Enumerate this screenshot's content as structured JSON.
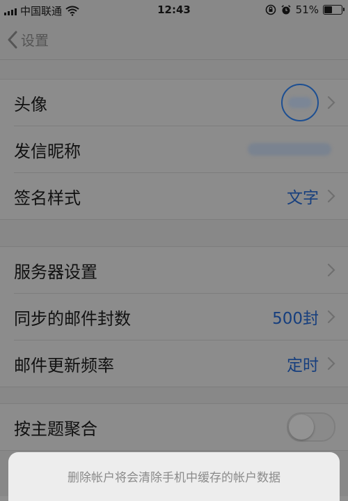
{
  "status_bar": {
    "carrier": "中国联通",
    "time": "12:43",
    "battery_text": "51%",
    "battery_level": 0.51
  },
  "nav": {
    "back_label": "设置"
  },
  "groups": [
    {
      "rows": [
        {
          "label": "头像",
          "value": ""
        },
        {
          "label": "发信昵称",
          "value": ""
        },
        {
          "label": "签名样式",
          "value": "文字"
        }
      ]
    },
    {
      "rows": [
        {
          "label": "服务器设置",
          "value": ""
        },
        {
          "label": "同步的邮件封数",
          "value": "500封"
        },
        {
          "label": "邮件更新频率",
          "value": "定时"
        }
      ]
    },
    {
      "rows": [
        {
          "label": "按主题聚合",
          "toggle_on": false
        }
      ]
    }
  ],
  "sheet": {
    "message": "删除帐户将会清除手机中缓存的帐户数据"
  },
  "colors": {
    "accent": "#173f7e",
    "overlay": "#888888",
    "sheet_bg": "#ededed"
  },
  "icons": [
    "signal-bars-icon",
    "wifi-icon",
    "rotation-lock-icon",
    "alarm-icon",
    "battery-icon",
    "back-chevron-icon",
    "chevron-right-icon"
  ]
}
